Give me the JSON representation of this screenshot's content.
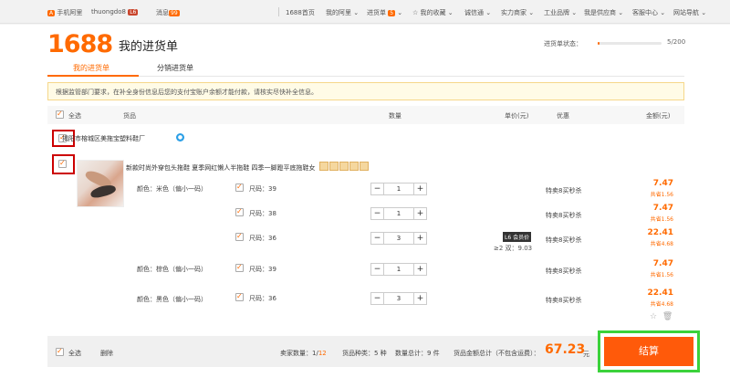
{
  "topbar": {
    "mobile": "手机阿里",
    "user": "thuongdo8",
    "user_level": "L6",
    "messages": "消息",
    "message_count": "99",
    "home": "1688首页",
    "my_ali": "我的阿里",
    "cart": "进货单",
    "cart_count": "5",
    "favorites": "我的收藏",
    "chengxintong": "诚信通",
    "power_merchant": "实力商家",
    "industrial": "工业品牌",
    "supplier": "我是供应商",
    "service": "客服中心",
    "sitenav": "网站导航"
  },
  "header": {
    "logo": "1688",
    "title": "我的进货单",
    "status_label": "进货单状态：",
    "progress_text": "5/200",
    "progress_fraction": 0.025
  },
  "tabs": [
    {
      "label": "我的进货单"
    },
    {
      "label": "分销进货单"
    }
  ],
  "notice": "根据监管部门要求，在补全身份信息后您的支付宝账户余额才能付款，请核实尽快补全信息。",
  "table_header": {
    "select_all": "全选",
    "product": "货品",
    "quantity": "数量",
    "unit_price": "单价(元)",
    "discount": "优惠",
    "amount": "金额(元)"
  },
  "shop": {
    "name": "揭阳市榕城区美拖宝塑料鞋厂"
  },
  "product": {
    "name": "新款时尚外穿包头拖鞋 夏季网红懒人半拖鞋 四季一脚蹬平底拖鞋女",
    "tier_badge": "L6 会员价",
    "tier_price": "≥2 双：9.03",
    "rows": [
      {
        "color": "颜色：米色（偏小一码）",
        "size": "尺码：39",
        "qty": "1",
        "promo": "特卖8买秒杀",
        "amount": "7.47",
        "save": "共省1.56"
      },
      {
        "color": "",
        "size": "尺码：38",
        "qty": "1",
        "promo": "特卖8买秒杀",
        "amount": "7.47",
        "save": "共省1.56"
      },
      {
        "color": "",
        "size": "尺码：36",
        "qty": "3",
        "promo": "特卖8买秒杀",
        "amount": "22.41",
        "save": "共省4.68"
      },
      {
        "color": "颜色：棕色（偏小一码）",
        "size": "尺码：39",
        "qty": "1",
        "promo": "特卖8买秒杀",
        "amount": "7.47",
        "save": "共省1.56"
      },
      {
        "color": "颜色：黑色（偏小一码）",
        "size": "尺码：36",
        "qty": "3",
        "promo": "特卖8买秒杀",
        "amount": "22.41",
        "save": "共省4.68"
      }
    ]
  },
  "footer": {
    "select_all": "全选",
    "delete": "删除",
    "seller_label": "卖家数量：",
    "seller_selected": "1",
    "seller_total": "12",
    "kinds": "货品种类：5 种",
    "qty_total": "数量总计：9 件",
    "total_label": "货品金额总计（不包含运费）：",
    "total": "67.23",
    "currency": "元",
    "checkout": "结算"
  },
  "colors": {
    "accent": "#ff6a00",
    "highlight_red": "#cc0000",
    "highlight_green": "#3bd23b"
  }
}
